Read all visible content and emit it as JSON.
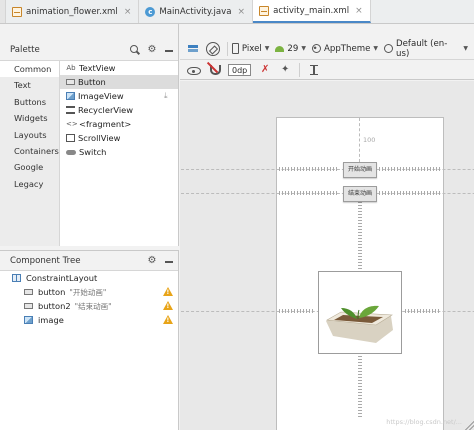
{
  "tabs": [
    {
      "label": "animation_flower.xml",
      "icon": "xml-file-icon",
      "active": false
    },
    {
      "label": "MainActivity.java",
      "icon": "java-class-icon",
      "active": false
    },
    {
      "label": "activity_main.xml",
      "icon": "xml-file-icon",
      "active": true
    }
  ],
  "tab_close": "×",
  "palette": {
    "title": "Palette",
    "categories": [
      "Common",
      "Text",
      "Buttons",
      "Widgets",
      "Layouts",
      "Containers",
      "Google",
      "Legacy"
    ],
    "selected_category": "Common",
    "items": [
      {
        "label": "TextView",
        "icon_text": "Ab"
      },
      {
        "label": "Button",
        "icon_text": ""
      },
      {
        "label": "ImageView",
        "icon_text": ""
      },
      {
        "label": "RecyclerView",
        "icon_text": ""
      },
      {
        "label": "<fragment>",
        "icon_text": "<>"
      },
      {
        "label": "ScrollView",
        "icon_text": ""
      },
      {
        "label": "Switch",
        "icon_text": ""
      }
    ],
    "selected_item": "Button"
  },
  "component_tree": {
    "title": "Component Tree",
    "root": "ConstraintLayout",
    "children": [
      {
        "label": "button",
        "text": "\"开始动画\"",
        "warning": true
      },
      {
        "label": "button2",
        "text": "\"结束动画\"",
        "warning": true
      },
      {
        "label": "image",
        "text": "",
        "warning": true
      }
    ]
  },
  "toolbar": {
    "device": "Pixel",
    "api": "29",
    "theme": "AppTheme",
    "locale": "Default (en-us)",
    "default_margin": "0dp"
  },
  "design": {
    "button1_text": "开始动画",
    "button2_text": "结束动画",
    "top_margin_label": "100",
    "watermark": "https://blog.csdn.net/..."
  },
  "colors": {
    "accent": "#4a88c7",
    "warning": "#e8a418"
  }
}
